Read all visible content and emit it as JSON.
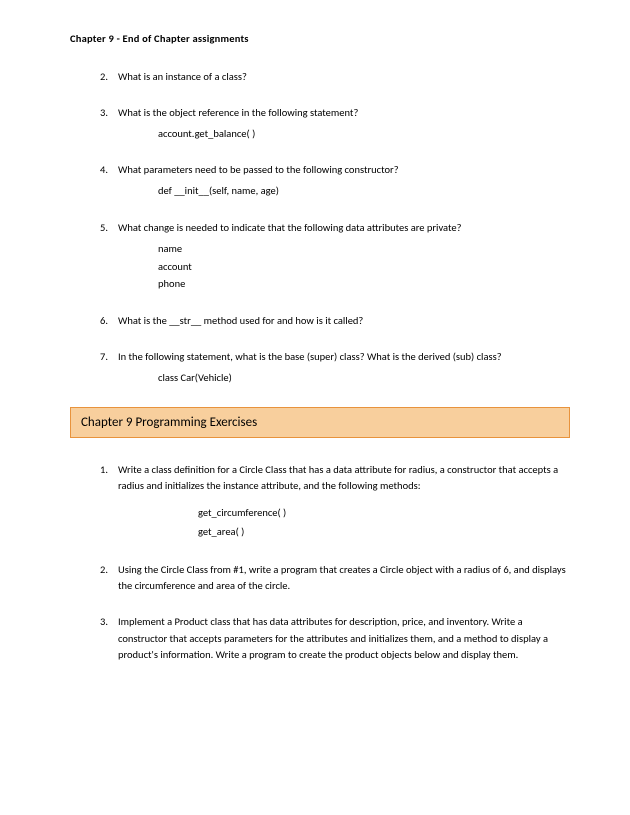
{
  "header": "Chapter 9 - End of Chapter assignments",
  "questions": [
    {
      "n": "2.",
      "text": "What is an instance of a class?",
      "code": []
    },
    {
      "n": "3.",
      "text": "What is the object reference in the following statement?",
      "code": [
        "account.get_balance( )"
      ]
    },
    {
      "n": "4.",
      "text": "What parameters need to be passed to the following constructor?",
      "code": [
        "def __init__(self, name, age)"
      ]
    },
    {
      "n": "5.",
      "text": "What change is needed to indicate that the following data attributes are private?",
      "code": [
        "name",
        "account",
        "phone"
      ]
    },
    {
      "n": "6.",
      "text": "What is the __str__ method used for and how is it called?",
      "code": []
    },
    {
      "n": "7.",
      "text": "In the following statement, what is the base (super) class?  What is the derived (sub) class?",
      "code": [
        "class Car(Vehicle)"
      ]
    }
  ],
  "section_title": "Chapter 9 Programming Exercises",
  "exercises": [
    {
      "n": "1.",
      "text": "Write a class definition for a Circle Class that has a data attribute for radius, a constructor that accepts a radius and initializes the instance attribute, and the following methods:",
      "code": [
        "get_circumference( )",
        "get_area( )"
      ]
    },
    {
      "n": "2.",
      "text": "Using the Circle Class from #1, write a program that creates a Circle object with a radius of 6, and displays the circumference and area of the circle.",
      "code": []
    },
    {
      "n": "3.",
      "text": "Implement a Product class that has data attributes for description, price, and inventory.  Write a constructor that accepts parameters for the attributes and initializes them, and a method to display a product's information.  Write a program to create the product objects below and display them.",
      "code": []
    }
  ]
}
